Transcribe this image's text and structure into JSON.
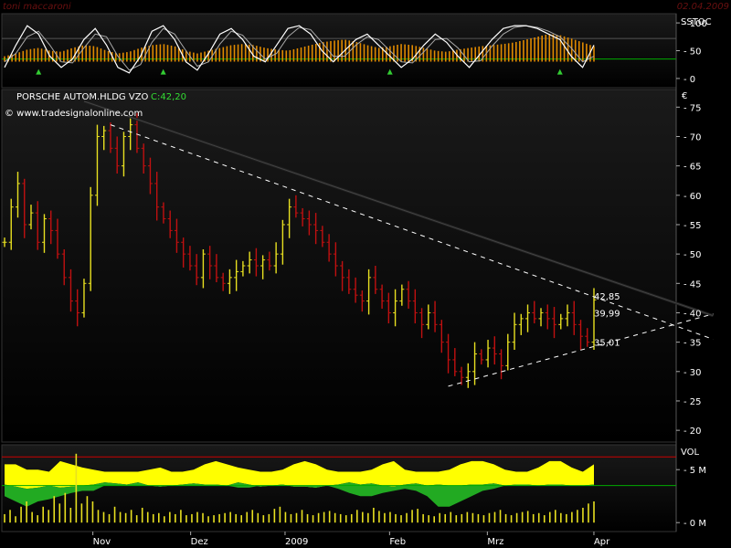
{
  "header": {
    "author": "toni maccaroni",
    "date": "02.04.2009"
  },
  "colors": {
    "up_bar": "#e8e020",
    "down_bar": "#c01010",
    "trend_line": "#202020",
    "dashed_line": "#ffffff",
    "sstoc_orange": "#e08a00",
    "vol_area": "#ffff00",
    "vol_green": "#22aa22",
    "ref_red": "#cc0000",
    "ref_green": "#00aa00",
    "signal_green": "#33cc33"
  },
  "chart_data": [
    {
      "id": "sstoc",
      "type": "line",
      "title": "SSTOC",
      "y_ticks": [
        "100",
        "50",
        "0"
      ],
      "ylim": [
        -10,
        110
      ],
      "reference_lines": [
        {
          "value": 72,
          "color": "#555555"
        },
        {
          "value": 35,
          "color": "#00aa00"
        }
      ],
      "series": [
        {
          "style": "orange-histogram",
          "color": "#e08a00",
          "values": [
            40,
            45,
            52,
            55,
            50,
            48,
            55,
            60,
            58,
            50,
            45,
            48,
            55,
            60,
            62,
            58,
            50,
            45,
            50,
            55,
            60,
            62,
            60,
            55,
            52,
            50,
            55,
            60,
            65,
            68,
            70,
            66,
            60,
            55,
            58,
            62,
            60,
            55,
            50,
            48,
            52,
            55,
            58,
            60,
            62,
            65,
            70,
            75,
            80,
            78,
            72,
            65,
            58
          ]
        },
        {
          "style": "white-line",
          "color": "#ffffff",
          "values": [
            20,
            60,
            95,
            80,
            40,
            20,
            35,
            70,
            90,
            60,
            20,
            10,
            40,
            85,
            95,
            70,
            30,
            15,
            45,
            80,
            90,
            70,
            40,
            30,
            60,
            90,
            95,
            80,
            50,
            30,
            50,
            70,
            80,
            60,
            40,
            20,
            35,
            60,
            80,
            65,
            40,
            20,
            45,
            70,
            90,
            95,
            95,
            90,
            80,
            70,
            40,
            20,
            60
          ]
        },
        {
          "style": "gray-line",
          "color": "#aaaaaa",
          "values": [
            30,
            45,
            75,
            85,
            60,
            30,
            28,
            55,
            80,
            75,
            40,
            15,
            25,
            65,
            90,
            80,
            50,
            22,
            30,
            62,
            85,
            78,
            55,
            35,
            45,
            75,
            92,
            88,
            65,
            40,
            40,
            60,
            75,
            70,
            50,
            30,
            28,
            48,
            70,
            72,
            55,
            30,
            32,
            58,
            80,
            92,
            95,
            92,
            85,
            75,
            55,
            30,
            40
          ]
        }
      ]
    },
    {
      "id": "price",
      "type": "bar",
      "style": "ohlc",
      "title": "PORSCHE AUTOM.HLDG VZO",
      "last_label": "C:42,20",
      "source": "© www.tradesignalonline.com",
      "currency": "€",
      "ylim": [
        18,
        78
      ],
      "y_ticks": [
        "75",
        "70",
        "65",
        "60",
        "55",
        "50",
        "45",
        "40",
        "35",
        "30",
        "25",
        "20"
      ],
      "x_labels": [
        {
          "label": "Nov",
          "pos": 0.135
        },
        {
          "label": "Dez",
          "pos": 0.28
        },
        {
          "label": "2009",
          "pos": 0.42
        },
        {
          "label": "Feb",
          "pos": 0.575
        },
        {
          "label": "Mrz",
          "pos": 0.72
        },
        {
          "label": "Apr",
          "pos": 0.878
        }
      ],
      "annotations": [
        {
          "text": "42,85",
          "value": 42.85
        },
        {
          "text": "39,99",
          "value": 39.99
        },
        {
          "text": "35,01",
          "value": 35.01
        }
      ],
      "closes": [
        52,
        58,
        62,
        55,
        57,
        52,
        56,
        54,
        50,
        46,
        42,
        40,
        45,
        60,
        70,
        71,
        68,
        65,
        70,
        72,
        68,
        65,
        62,
        58,
        56,
        54,
        52,
        50,
        48,
        46,
        50,
        48,
        46,
        45,
        46,
        47,
        48,
        49,
        48,
        49,
        48,
        50,
        55,
        58,
        57,
        56,
        55,
        54,
        52,
        50,
        48,
        46,
        44,
        43,
        42,
        46,
        44,
        42,
        40,
        42,
        44,
        42,
        40,
        38,
        40,
        38,
        35,
        32,
        30,
        29,
        30,
        33,
        32,
        34,
        33,
        31,
        35,
        38,
        39,
        40,
        39,
        40,
        39,
        38,
        39,
        40,
        38,
        36,
        35,
        42.2
      ],
      "trend_lines": [
        {
          "style": "solid-dark",
          "from": {
            "i": 12,
            "v": 76
          },
          "to": {
            "i": 107,
            "v": 39.5
          }
        },
        {
          "style": "dashed",
          "from": {
            "i": 16,
            "v": 72
          },
          "to": {
            "i": 107,
            "v": 35.5
          }
        },
        {
          "style": "dashed",
          "from": {
            "i": 67,
            "v": 27.5
          },
          "to": {
            "i": 107,
            "v": 39.8
          }
        }
      ]
    },
    {
      "id": "vol",
      "type": "area",
      "title": "VOL",
      "y_ticks": [
        {
          "label": "5 M",
          "value": 5
        },
        {
          "label": "0 M",
          "value": 0
        }
      ],
      "ylim": [
        -0.5,
        7
      ],
      "reference_lines": [
        {
          "value": 6.2,
          "color": "#cc0000"
        },
        {
          "value": 3.5,
          "color": "#00aa00"
        }
      ],
      "yellow_upper": [
        5.5,
        5.5,
        5.0,
        5.0,
        4.8,
        5.8,
        5.5,
        5.2,
        5.0,
        4.8,
        4.8,
        4.8,
        4.8,
        5.0,
        5.2,
        4.8,
        4.8,
        5.0,
        5.5,
        5.8,
        5.5,
        5.2,
        5.0,
        4.8,
        4.8,
        5.0,
        5.5,
        5.8,
        5.5,
        5.0,
        4.8,
        4.8,
        4.8,
        5.0,
        5.5,
        5.8,
        5.0,
        4.8,
        4.8,
        4.8,
        5.0,
        5.5,
        5.8,
        5.8,
        5.5,
        5.0,
        4.8,
        4.8,
        5.2,
        5.8,
        5.8,
        5.2,
        4.8,
        5.5
      ],
      "yellow_lower": [
        3.6,
        3.4,
        3.2,
        3.3,
        3.5,
        3.3,
        3.4,
        3.5,
        3.6,
        3.8,
        3.7,
        3.6,
        3.8,
        3.5,
        3.4,
        3.5,
        3.6,
        3.7,
        3.6,
        3.6,
        3.5,
        3.8,
        3.6,
        3.4,
        3.5,
        3.6,
        3.4,
        3.4,
        3.3,
        3.5,
        3.6,
        3.8,
        3.6,
        3.7,
        3.5,
        3.4,
        3.6,
        3.7,
        3.5,
        3.6,
        3.5,
        3.5,
        3.6,
        3.6,
        3.7,
        3.5,
        3.6,
        3.6,
        3.5,
        3.6,
        3.6,
        3.5,
        3.5,
        3.6
      ],
      "green_bottom": [
        2.5,
        2.0,
        1.5,
        2.0,
        2.2,
        2.5,
        2.8,
        3.0,
        3.0,
        3.5,
        3.5,
        3.5,
        3.5,
        3.5,
        3.5,
        3.5,
        3.5,
        3.5,
        3.5,
        3.5,
        3.5,
        3.3,
        3.3,
        3.5,
        3.5,
        3.5,
        3.5,
        3.5,
        3.5,
        3.5,
        3.2,
        2.8,
        2.5,
        2.5,
        2.8,
        3.0,
        3.2,
        3.0,
        2.5,
        1.5,
        1.5,
        2.0,
        2.5,
        3.0,
        3.2,
        3.5,
        3.5,
        3.5,
        3.5,
        3.5,
        3.5,
        3.5,
        3.5,
        3.5
      ],
      "bars": [
        0.8,
        1.2,
        0.6,
        1.5,
        2.0,
        1.0,
        0.7,
        1.5,
        1.2,
        2.5,
        1.8,
        2.8,
        1.4,
        6.5,
        1.8,
        2.5,
        2.0,
        1.2,
        1.0,
        0.8,
        1.5,
        1.0,
        0.9,
        1.2,
        0.7,
        1.4,
        1.0,
        0.8,
        0.9,
        0.6,
        1.0,
        0.8,
        1.2,
        0.7,
        0.8,
        1.0,
        0.9,
        0.6,
        0.7,
        0.8,
        0.9,
        1.0,
        0.8,
        0.7,
        1.0,
        1.2,
        0.9,
        0.7,
        0.8,
        1.3,
        1.5,
        1.0,
        0.8,
        0.9,
        1.2,
        0.8,
        0.7,
        0.9,
        1.0,
        1.1,
        0.9,
        0.8,
        0.7,
        0.8,
        1.2,
        1.0,
        0.9,
        1.4,
        1.1,
        0.9,
        1.0,
        0.8,
        0.7,
        0.9,
        1.2,
        1.3,
        0.8,
        0.7,
        0.6,
        0.9,
        0.8,
        1.0,
        0.7,
        0.8,
        1.0,
        0.9,
        0.8,
        0.7,
        0.9,
        1.0,
        1.2,
        0.8,
        0.7,
        0.9,
        1.0,
        1.1,
        0.8,
        0.9,
        0.7,
        1.0,
        1.2,
        0.9,
        0.8,
        1.0,
        1.2,
        1.4,
        1.8,
        2.0
      ]
    }
  ]
}
